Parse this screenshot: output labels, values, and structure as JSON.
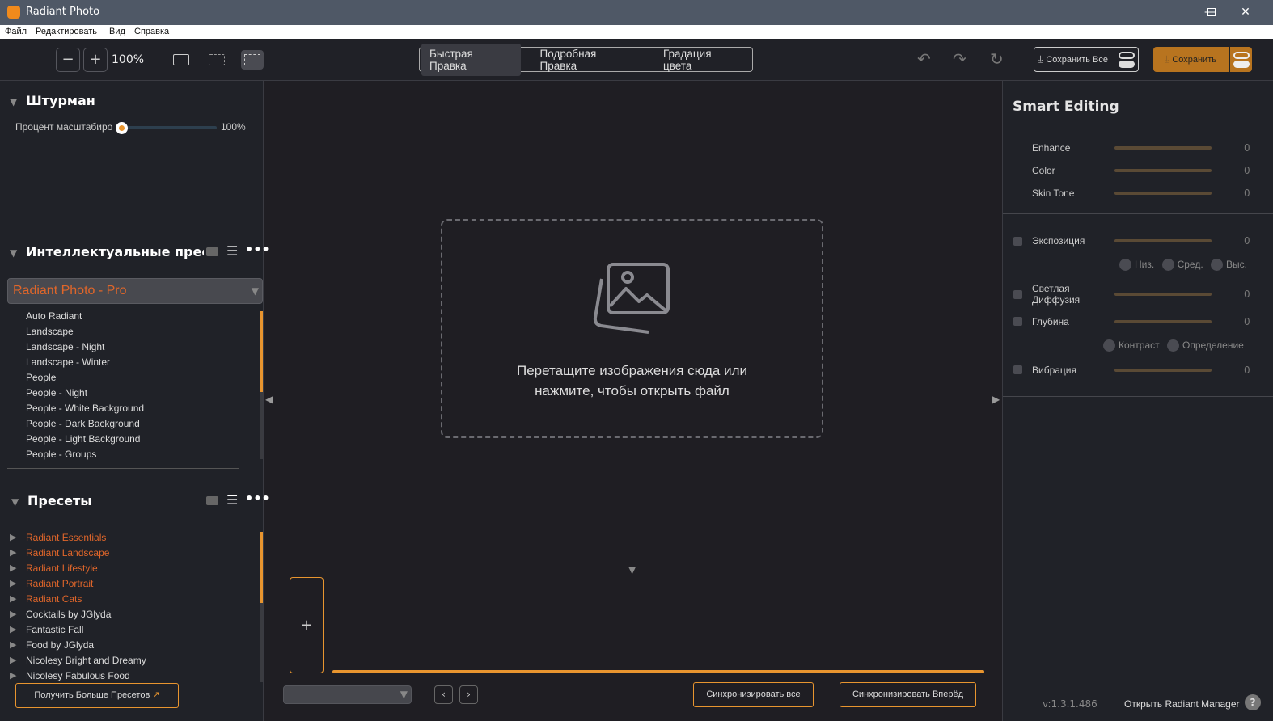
{
  "app": {
    "title": "Radiant Photo"
  },
  "menu": [
    "Файл",
    "Редактировать",
    "Вид",
    "Справка"
  ],
  "toolbar": {
    "zoom": "100%",
    "tabs": [
      "Быстрая Правка",
      "Подробная Правка",
      "Градация цвета"
    ],
    "save_all": "Сохранить Все",
    "save": "Сохранить"
  },
  "navigator": {
    "title": "Штурман",
    "zoom_label": "Процент масштабиро",
    "zoom_value": "100%",
    "zoom_fraction": 0
  },
  "smart_presets": {
    "title": "Интеллектуальные пресет",
    "selected": "Radiant Photo - Pro",
    "items": [
      "Auto Radiant",
      "Landscape",
      "Landscape - Night",
      "Landscape - Winter",
      "People",
      "People - Night",
      "People - White Background",
      "People - Dark Background",
      "People - Light Background",
      "People - Groups"
    ]
  },
  "presets": {
    "title": "Пресеты",
    "items": [
      {
        "label": "Radiant Essentials",
        "accent": true
      },
      {
        "label": "Radiant Landscape",
        "accent": true
      },
      {
        "label": "Radiant Lifestyle",
        "accent": true
      },
      {
        "label": "Radiant Portrait",
        "accent": true
      },
      {
        "label": "Radiant Cats",
        "accent": true
      },
      {
        "label": "Cocktails by JGlyda",
        "accent": false
      },
      {
        "label": "Fantastic Fall",
        "accent": false
      },
      {
        "label": "Food by JGlyda",
        "accent": false
      },
      {
        "label": "Nicolesy Bright and Dreamy",
        "accent": false
      },
      {
        "label": "Nicolesy Fabulous Food",
        "accent": false
      }
    ],
    "get_more": "Получить Больше Пресетов"
  },
  "canvas": {
    "drop_text_1": "Перетащите изображения сюда или",
    "drop_text_2": "нажмите, чтобы открыть файл",
    "add": "+",
    "sync_all": "Синхронизировать все",
    "sync_forward": "Синхронизировать Вперёд"
  },
  "smart_editing": {
    "title": "Smart Editing",
    "sliders": [
      {
        "label": "Enhance",
        "value": "0"
      },
      {
        "label": "Color",
        "value": "0"
      },
      {
        "label": "Skin Tone",
        "value": "0"
      }
    ]
  },
  "adjustments": {
    "exposure": {
      "label": "Экспозиция",
      "value": "0",
      "options": [
        "Низ.",
        "Сред.",
        "Выс."
      ]
    },
    "diffusion": {
      "label1": "Светлая",
      "label2": "Диффузия",
      "value": "0"
    },
    "depth": {
      "label": "Глубина",
      "value": "0",
      "options": [
        "Контраст",
        "Определение"
      ]
    },
    "vibrance": {
      "label": "Вибрация",
      "value": "0"
    }
  },
  "footer": {
    "version": "v:1.3.1.486",
    "manager": "Открыть Radiant Manager",
    "help": "?"
  },
  "colors": {
    "accent": "#e8952f",
    "preset_accent": "#e0662a"
  }
}
